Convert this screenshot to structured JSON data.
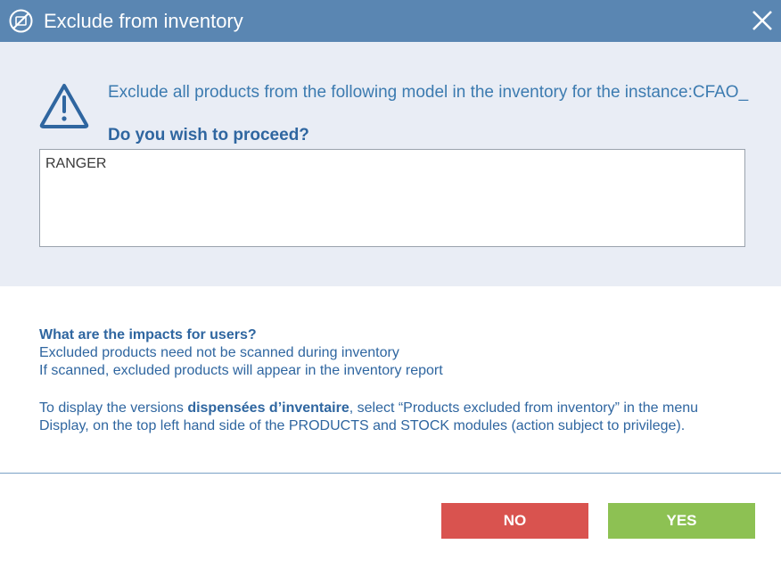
{
  "dialog": {
    "title": "Exclude from inventory",
    "message": "Exclude all products from the following model in the inventory for the instance:CFAO_",
    "question": "Do you wish to proceed?",
    "model_list": "RANGER"
  },
  "info": {
    "heading": "What are the impacts for users?",
    "line1": "Excluded products need not be scanned during inventory",
    "line2": "If scanned, excluded products will appear in the inventory report",
    "display_prefix": "To display the versions ",
    "display_bold": "dispensées d’inventaire",
    "display_suffix": ", select “Products excluded from inventory” in the menu",
    "display_line2": "Display, on the top left hand side of the PRODUCTS and STOCK modules (action subject to privilege)."
  },
  "buttons": {
    "no_label": "NO",
    "yes_label": "YES"
  },
  "icons": {
    "title_icon": "excluded-icon",
    "warning_icon": "warning-triangle-icon",
    "close_icon": "close-icon"
  },
  "colors": {
    "titlebar": "#5a86b2",
    "panel": "#e9edf5",
    "no_button": "#d9534f",
    "yes_button": "#8dc153",
    "text_blue": "#2f66a0"
  }
}
